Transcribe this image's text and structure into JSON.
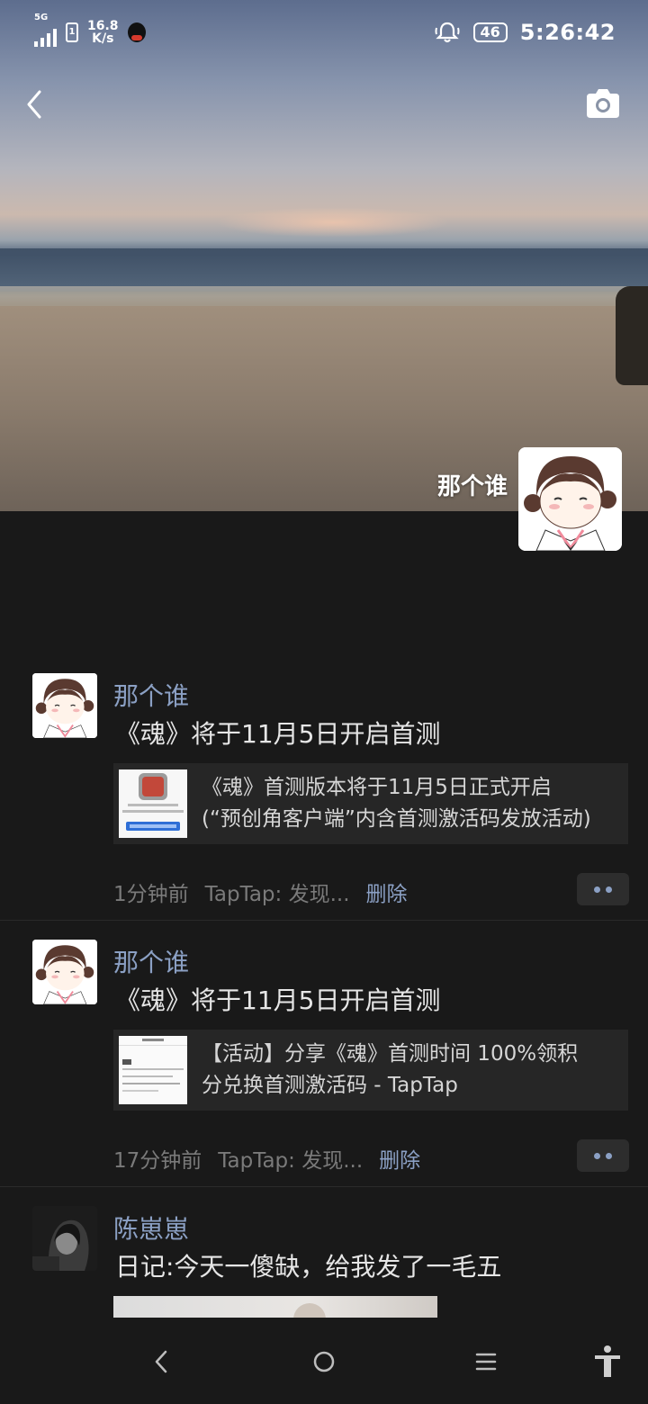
{
  "status_bar": {
    "network": "5G",
    "speed_value": "16.8",
    "speed_unit": "K/s",
    "battery": "46",
    "time": "5:26:42"
  },
  "header": {
    "back_icon": "chevron-left-icon",
    "camera_icon": "camera-icon"
  },
  "profile": {
    "name": "那个谁"
  },
  "posts": [
    {
      "name": "那个谁",
      "text": "《魂》将于11月5日开启首测",
      "link_line1": "《魂》首测版本将于11月5日正式开启",
      "link_line2": "(“预创角客户端”内含首测激活码发放活动)",
      "time": "1分钟前",
      "source": "TapTap: 发现...",
      "delete": "删除"
    },
    {
      "name": "那个谁",
      "text": "《魂》将于11月5日开启首测",
      "link_line1": "【活动】分享《魂》首测时间 100%领积",
      "link_line2": "分兑换首测激活码 - TapTap",
      "time": "17分钟前",
      "source": "TapTap: 发现...",
      "delete": "删除"
    },
    {
      "name": "陈崽崽",
      "text": "日记:今天一傻缺，给我发了一毛五"
    }
  ],
  "nav": {
    "back": "back-icon",
    "home": "home-icon",
    "menu": "menu-icon",
    "accessibility": "accessibility-icon"
  },
  "colors": {
    "background": "#191919",
    "name_link": "#8ba0c4",
    "card": "#262626"
  }
}
